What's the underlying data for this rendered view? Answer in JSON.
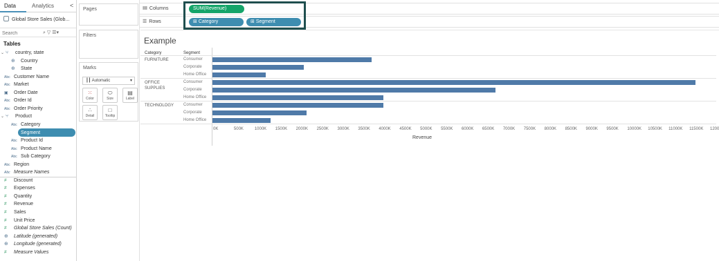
{
  "data_pane": {
    "tabs": [
      {
        "label": "Data",
        "active": true
      },
      {
        "label": "Analytics",
        "active": false
      }
    ],
    "collapse_label": "<",
    "datasource": "Global Store Sales (Glob...",
    "search_placeholder": "Search",
    "tables_heading": "Tables",
    "fields": [
      {
        "label": "country, state",
        "icon": "hierarchy-icon",
        "level": 0
      },
      {
        "label": "Country",
        "icon": "globe-icon",
        "level": 1
      },
      {
        "label": "State",
        "icon": "globe-icon",
        "level": 1
      },
      {
        "label": "Customer Name",
        "icon": "abc-icon",
        "level": 0
      },
      {
        "label": "Market",
        "icon": "abc-icon",
        "level": 0
      },
      {
        "label": "Order Date",
        "icon": "calendar-icon",
        "level": 0
      },
      {
        "label": "Order Id",
        "icon": "abc-icon",
        "level": 0
      },
      {
        "label": "Order Priority",
        "icon": "abc-icon",
        "level": 0
      },
      {
        "label": "Product",
        "icon": "hierarchy-icon",
        "level": 0
      },
      {
        "label": "Category",
        "icon": "abc-icon",
        "level": 1
      },
      {
        "label": "Segment",
        "icon": "abc-icon",
        "level": 1,
        "selected": true
      },
      {
        "label": "Product Id",
        "icon": "abc-icon",
        "level": 1
      },
      {
        "label": "Product Name",
        "icon": "abc-icon",
        "level": 1
      },
      {
        "label": "Sub Category",
        "icon": "abc-icon",
        "level": 1
      },
      {
        "label": "Region",
        "icon": "abc-icon",
        "level": 0
      },
      {
        "label": "Measure Names",
        "icon": "abc-icon",
        "level": 0,
        "italic": true
      },
      {
        "label": "Discount",
        "icon": "measure-icon",
        "level": 0
      },
      {
        "label": "Expenses",
        "icon": "measure-icon",
        "level": 0
      },
      {
        "label": "Quantity",
        "icon": "measure-icon",
        "level": 0
      },
      {
        "label": "Revenue",
        "icon": "measure-icon",
        "level": 0
      },
      {
        "label": "Sales",
        "icon": "measure-icon",
        "level": 0
      },
      {
        "label": "Unit Price",
        "icon": "measure-icon",
        "level": 0
      },
      {
        "label": "Global Store Sales (Count)",
        "icon": "measure-icon",
        "level": 0,
        "italic": true
      },
      {
        "label": "Latitude (generated)",
        "icon": "globe-icon",
        "level": 0,
        "italic": true
      },
      {
        "label": "Longitude (generated)",
        "icon": "globe-icon",
        "level": 0,
        "italic": true
      },
      {
        "label": "Measure Values",
        "icon": "measure-icon",
        "level": 0,
        "italic": true
      }
    ]
  },
  "cards": {
    "pages": "Pages",
    "filters": "Filters",
    "marks": "Marks",
    "mark_type": "Automatic",
    "buttons": {
      "color": "Color",
      "size": "Size",
      "label": "Label",
      "detail": "Detail",
      "tooltip": "Tooltip"
    }
  },
  "shelves": {
    "columns_label": "Columns",
    "rows_label": "Rows",
    "columns_pills": [
      "SUM(Revenue)"
    ],
    "rows_pills": [
      "Category",
      "Segment"
    ]
  },
  "view": {
    "title": "Example",
    "header_category": "Category",
    "header_segment": "Segment",
    "axis_title": "Revenue"
  },
  "chart_data": {
    "type": "bar",
    "orientation": "horizontal",
    "title": "Example",
    "xlabel": "Revenue",
    "xlim": [
      0,
      12000000
    ],
    "x_ticks": [
      "0K",
      "500K",
      "1000K",
      "1500K",
      "2000K",
      "2500K",
      "3000K",
      "3500K",
      "4000K",
      "4500K",
      "5000K",
      "5500K",
      "6000K",
      "6500K",
      "7000K",
      "7500K",
      "8000K",
      "8500K",
      "9000K",
      "9500K",
      "10000K",
      "10500K",
      "11000K",
      "11500K",
      "12000K"
    ],
    "groups": [
      {
        "category": "FURNITURE",
        "segments": [
          "Consumer",
          "Corporate",
          "Home Office"
        ],
        "values": [
          3850000,
          2200000,
          1280000
        ]
      },
      {
        "category": "OFFICE SUPPLIES",
        "segments": [
          "Consumer",
          "Corporate",
          "Home Office"
        ],
        "values": [
          11670000,
          6830000,
          4130000
        ]
      },
      {
        "category": "TECHNOLOGY",
        "segments": [
          "Consumer",
          "Corporate",
          "Home Office"
        ],
        "values": [
          4120000,
          2280000,
          1400000
        ]
      }
    ],
    "bar_color": "#4f7aa8",
    "grid": false
  }
}
